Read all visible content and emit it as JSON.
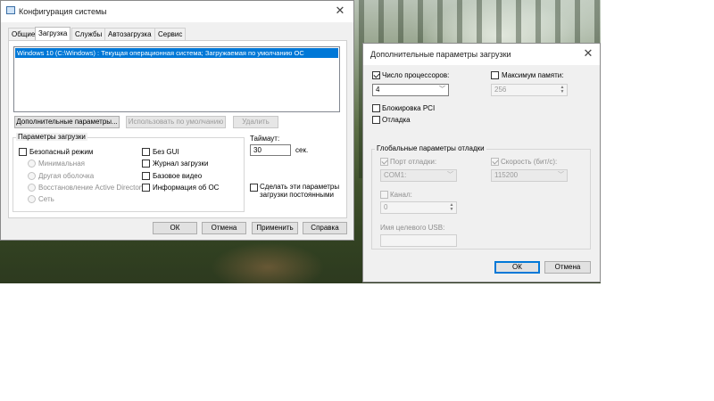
{
  "main_window": {
    "title": "Конфигурация системы",
    "tabs": [
      {
        "label": "Общие"
      },
      {
        "label": "Загрузка"
      },
      {
        "label": "Службы"
      },
      {
        "label": "Автозагрузка"
      },
      {
        "label": "Сервис"
      }
    ],
    "os_entry": "Windows 10 (C:\\Windows) : Текущая операционная система; Загружаемая по умолчанию ОС",
    "buttons": {
      "advanced": "Дополнительные параметры...",
      "set_default": "Использовать по умолчанию",
      "delete": "Удалить",
      "ok": "ОК",
      "cancel": "Отмена",
      "apply": "Применить",
      "help": "Справка"
    },
    "boot_options": {
      "title": "Параметры загрузки",
      "safe_boot": "Безопасный режим",
      "minimal": "Минимальная",
      "alternate_shell": "Другая оболочка",
      "ad_repair": "Восстановление Active Directory",
      "network": "Сеть",
      "no_gui": "Без GUI",
      "boot_log": "Журнал загрузки",
      "base_video": "Базовое видео",
      "os_boot_info": "Информация  об ОС"
    },
    "timeout": {
      "label": "Таймаут:",
      "value": "30",
      "unit": "сек."
    },
    "make_permanent": {
      "line1": "Сделать эти параметры",
      "line2": "загрузки постоянными"
    }
  },
  "dialog": {
    "title": "Дополнительные параметры загрузки",
    "num_processors": {
      "label": "Число процессоров:",
      "checked": true,
      "value": "4"
    },
    "max_memory": {
      "label": "Максимум памяти:",
      "checked": false,
      "value": "256"
    },
    "pci_lock": {
      "label": "Блокировка PCI",
      "checked": false
    },
    "debug": {
      "label": "Отладка",
      "checked": false
    },
    "global_debug": {
      "title": "Глобальные параметры отладки",
      "debug_port": {
        "label": "Порт отладки:",
        "value": "COM1:"
      },
      "baud_rate": {
        "label": "Скорость (бит/с):",
        "value": "115200"
      },
      "channel": {
        "label": "Канал:",
        "value": "0"
      },
      "usb_target": {
        "label": "Имя целевого USB:",
        "value": ""
      }
    },
    "buttons": {
      "ok": "ОК",
      "cancel": "Отмена"
    }
  }
}
